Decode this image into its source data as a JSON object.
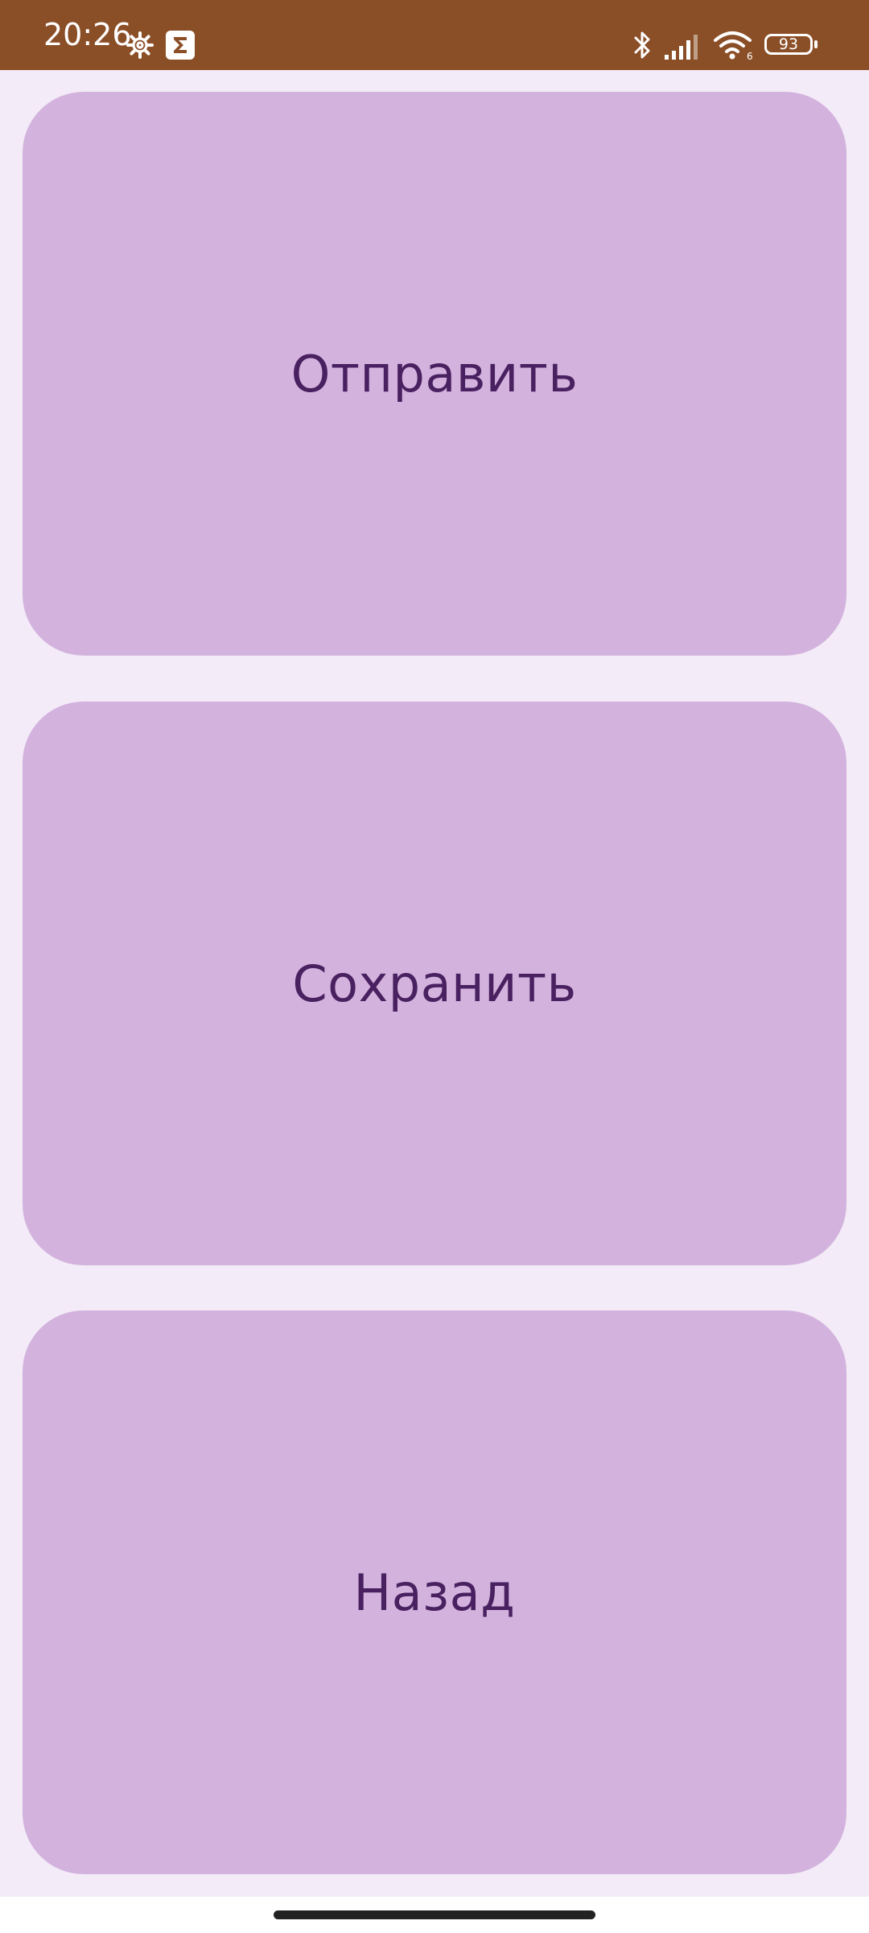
{
  "status_bar": {
    "time": "20:26",
    "signal_network_label": "6",
    "battery_level": "93"
  },
  "buttons": [
    {
      "label": "Отправить"
    },
    {
      "label": "Сохранить"
    },
    {
      "label": "Назад"
    }
  ],
  "colors": {
    "status_bar_bg": "#8b4f27",
    "page_bg": "#f3ebf7",
    "button_bg": "#d3b3de",
    "button_text": "#4a2160"
  }
}
